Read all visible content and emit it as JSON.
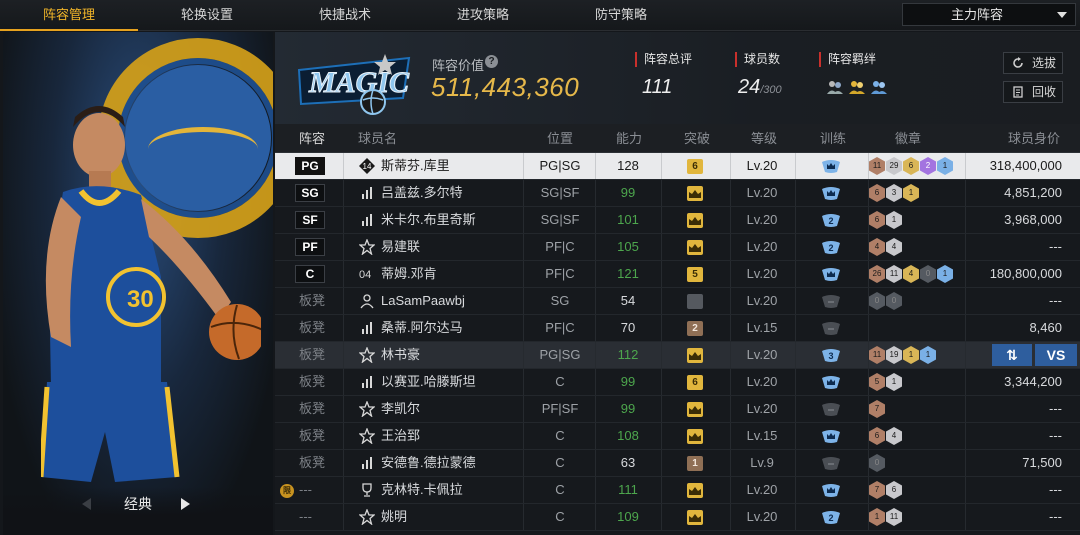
{
  "nav": {
    "tabs": [
      {
        "label": "阵容管理",
        "active": true
      },
      {
        "label": "轮换设置",
        "active": false
      },
      {
        "label": "快捷战术",
        "active": false
      },
      {
        "label": "进攻策略",
        "active": false
      },
      {
        "label": "防守策略",
        "active": false
      }
    ],
    "lineup_select": "主力阵容"
  },
  "hero": {
    "label": "经典"
  },
  "team": {
    "value_label": "阵容价值",
    "value": "511,443,360",
    "rating_label": "阵容总评",
    "rating": "111",
    "roster_label": "球员数",
    "roster_count": "24",
    "roster_max": "/300",
    "chem_label": "阵容羁绊",
    "chem_icons": [
      "chem-icon-1",
      "chem-icon-2",
      "chem-icon-3"
    ],
    "btn_select": "选拔",
    "btn_recycle": "回收"
  },
  "colors": {
    "accent": "#f0b429",
    "gold": "#e6b84a",
    "green": "#4da64d",
    "blue": "#2e5e9e",
    "red": "#c9302c"
  },
  "table": {
    "headers": [
      "阵容",
      "球员名",
      "位置",
      "能力",
      "突破",
      "等级",
      "训练",
      "徽章",
      "球员身价"
    ],
    "rows": [
      {
        "slot": "PG",
        "name": "斯蒂芬.库里",
        "type": "jersey",
        "jersey": "14",
        "pos": "PG|SG",
        "rating": "128",
        "green": false,
        "brk": "6",
        "brk_style": "gold",
        "level": "Lv.20",
        "train": "blue-crown",
        "badges": [
          [
            "11",
            "br"
          ],
          [
            "29",
            "sv"
          ],
          [
            "6",
            "gd"
          ],
          [
            "2",
            "pu"
          ],
          [
            "1",
            "bl"
          ]
        ],
        "salary": "318,400,000",
        "selected": true
      },
      {
        "slot": "SG",
        "name": "吕盖兹.多尔特",
        "type": "stats",
        "pos": "SG|SF",
        "rating": "99",
        "green": true,
        "brk": "",
        "brk_style": "gold",
        "level": "Lv.20",
        "train": "blue-crown",
        "badges": [
          [
            "6",
            "br"
          ],
          [
            "3",
            "sv"
          ],
          [
            "1",
            "gd"
          ]
        ],
        "salary": "4,851,200"
      },
      {
        "slot": "SF",
        "name": "米卡尔.布里奇斯",
        "type": "stats",
        "pos": "SG|SF",
        "rating": "101",
        "green": true,
        "brk": "",
        "brk_style": "gold",
        "level": "Lv.20",
        "train": "blue-2",
        "badges": [
          [
            "6",
            "br"
          ],
          [
            "1",
            "sv"
          ]
        ],
        "salary": "3,968,000"
      },
      {
        "slot": "PF",
        "name": "易建联",
        "type": "star",
        "pos": "PF|C",
        "rating": "105",
        "green": true,
        "brk": "",
        "brk_style": "gold",
        "level": "Lv.20",
        "train": "blue-2",
        "badges": [
          [
            "4",
            "br"
          ],
          [
            "4",
            "sv"
          ]
        ],
        "salary": "---"
      },
      {
        "slot": "C",
        "name": "蒂姆.邓肯",
        "type": "number",
        "number": "04",
        "pos": "PF|C",
        "rating": "121",
        "green": true,
        "brk": "5",
        "brk_style": "gold",
        "level": "Lv.20",
        "train": "blue-crown",
        "badges": [
          [
            "26",
            "br"
          ],
          [
            "11",
            "sv"
          ],
          [
            "4",
            "gd"
          ],
          [
            "0",
            "dk"
          ],
          [
            "1",
            "bl"
          ]
        ],
        "salary": "180,800,000"
      },
      {
        "slot": "板凳",
        "name": "LaSamPaawbj",
        "type": "person",
        "pos": "SG",
        "rating": "54",
        "green": false,
        "brk": "",
        "brk_style": "grey",
        "level": "Lv.20",
        "train": "grey",
        "badges": [
          [
            "0",
            "dk"
          ],
          [
            "0",
            "dk"
          ]
        ],
        "salary": "---"
      },
      {
        "slot": "板凳",
        "name": "桑蒂.阿尔达马",
        "type": "stats",
        "pos": "PF|C",
        "rating": "70",
        "green": false,
        "brk": "2",
        "brk_style": "bronze",
        "level": "Lv.15",
        "train": "grey",
        "badges": [],
        "salary": "8,460"
      },
      {
        "slot": "板凳",
        "name": "林书豪",
        "type": "star",
        "pos": "PG|SG",
        "rating": "112",
        "green": true,
        "brk": "",
        "brk_style": "gold",
        "level": "Lv.20",
        "train": "blue-3",
        "badges": [
          [
            "11",
            "br"
          ],
          [
            "19",
            "sv"
          ],
          [
            "1",
            "gd"
          ],
          [
            "1",
            "bl"
          ]
        ],
        "salary": "",
        "highlight": true,
        "swap_label": "⇅",
        "vs_label": "VS"
      },
      {
        "slot": "板凳",
        "name": "以赛亚.哈滕斯坦",
        "type": "stats",
        "pos": "C",
        "rating": "99",
        "green": true,
        "brk": "6",
        "brk_style": "gold",
        "level": "Lv.20",
        "train": "blue-crown",
        "badges": [
          [
            "5",
            "br"
          ],
          [
            "1",
            "sv"
          ]
        ],
        "salary": "3,344,200"
      },
      {
        "slot": "板凳",
        "name": "李凯尔",
        "type": "star",
        "pos": "PF|SF",
        "rating": "99",
        "green": true,
        "brk": "",
        "brk_style": "gold",
        "level": "Lv.20",
        "train": "grey",
        "badges": [
          [
            "7",
            "br"
          ]
        ],
        "salary": "---"
      },
      {
        "slot": "板凳",
        "name": "王治郅",
        "type": "star",
        "pos": "C",
        "rating": "108",
        "green": true,
        "brk": "",
        "brk_style": "gold",
        "level": "Lv.15",
        "train": "blue-crown",
        "badges": [
          [
            "6",
            "br"
          ],
          [
            "4",
            "sv"
          ]
        ],
        "salary": "---"
      },
      {
        "slot": "板凳",
        "name": "安德鲁.德拉蒙德",
        "type": "stats",
        "pos": "C",
        "rating": "63",
        "green": false,
        "brk": "1",
        "brk_style": "bronze",
        "level": "Lv.9",
        "train": "grey",
        "badges": [
          [
            "0",
            "dk"
          ]
        ],
        "salary": "71,500"
      },
      {
        "slot": "---",
        "name": "克林特.卡佩拉",
        "type": "trophy",
        "pos": "C",
        "rating": "111",
        "green": true,
        "brk": "",
        "brk_style": "gold",
        "level": "Lv.20",
        "train": "blue-crown",
        "badges": [
          [
            "7",
            "br"
          ],
          [
            "6",
            "sv"
          ]
        ],
        "salary": "---",
        "limited": "限"
      },
      {
        "slot": "---",
        "name": "姚明",
        "type": "star",
        "pos": "C",
        "rating": "109",
        "green": true,
        "brk": "",
        "brk_style": "gold",
        "level": "Lv.20",
        "train": "blue-2",
        "badges": [
          [
            "1",
            "br"
          ],
          [
            "11",
            "sv"
          ]
        ],
        "salary": "---"
      }
    ]
  }
}
